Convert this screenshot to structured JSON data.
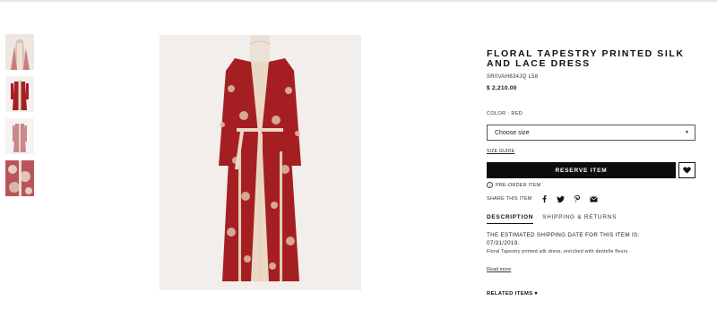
{
  "thumbnails": [
    {
      "label": "detail view"
    },
    {
      "label": "front view"
    },
    {
      "label": "back view"
    },
    {
      "label": "fabric view"
    }
  ],
  "product": {
    "title": "FLORAL TAPESTRY PRINTED SILK AND LACE DRESS",
    "sku": "SR0VAH634JQ L58",
    "price": "$ 2,210.00",
    "color_label": "COLOR : RED",
    "size_select": {
      "selected": "Choose size"
    },
    "size_guide": "SIZE GUIDE",
    "reserve_button": "RESERVE ITEM",
    "preorder": "PRE-ORDER ITEM",
    "share_label": "SHARE THIS ITEM",
    "share_icons": [
      "facebook-icon",
      "twitter-icon",
      "pinterest-icon",
      "email-icon"
    ]
  },
  "tabs": {
    "description": "DESCRIPTION",
    "shipping": "SHIPPING & RETURNS"
  },
  "description": {
    "shipping_text": "THE ESTIMATED SHIPPING DATE FOR THIS ITEM IS: 07/31/2019.",
    "body": "Floral Tapestry printed silk dress, enriched with dentelle fleurs",
    "read_more": "Read more"
  },
  "related": "RELATED ITEMS ▾",
  "colors": {
    "dress_red": "#a51f22",
    "lace": "#ead8c4",
    "button_black": "#0d0d0d"
  }
}
